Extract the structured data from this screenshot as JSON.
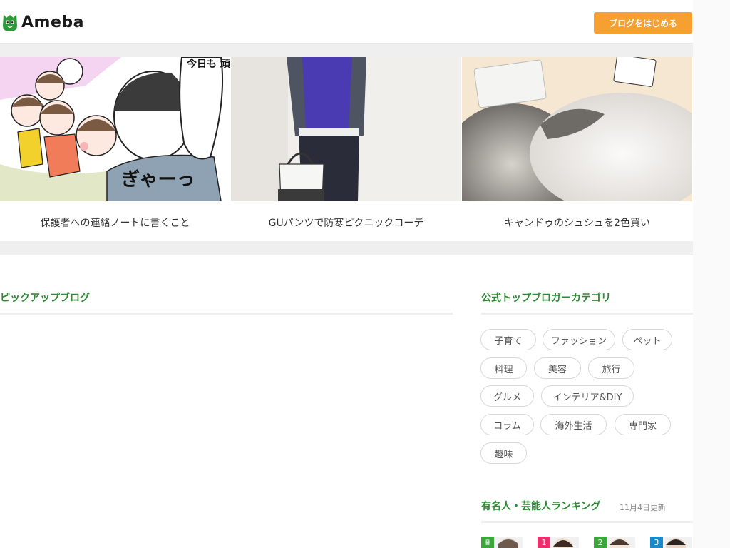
{
  "header": {
    "logo_text": "Ameba",
    "start_blog_label": "ブログをはじめる"
  },
  "carousel": {
    "items": [
      {
        "caption": "保護者への連絡ノートに書くこと",
        "speech": "今日も 頑張ったね〜!",
        "sfx": "ぎゃーっ"
      },
      {
        "caption": "GUパンツで防寒ピクニックコーデ"
      },
      {
        "caption": "キャンドゥのシュシュを2色買い"
      }
    ]
  },
  "pickup": {
    "title": "ピックアップブログ"
  },
  "categories": {
    "title": "公式トップブロガーカテゴリ",
    "tags": [
      "子育て",
      "ファッション",
      "ペット",
      "料理",
      "美容",
      "旅行",
      "グルメ",
      "インテリア&DIY",
      "コラム",
      "海外生活",
      "専門家",
      "趣味"
    ]
  },
  "ranking": {
    "title": "有名人・芸能人ランキング",
    "updated": "11月4日更新",
    "badges": [
      "♛",
      "1",
      "2",
      "3"
    ],
    "badge_colors": [
      "#3aa63c",
      "#e8336e",
      "#3aa63c",
      "#1b88c9"
    ]
  },
  "colors": {
    "accent_green": "#2d8a34",
    "orange": "#f5a031"
  }
}
